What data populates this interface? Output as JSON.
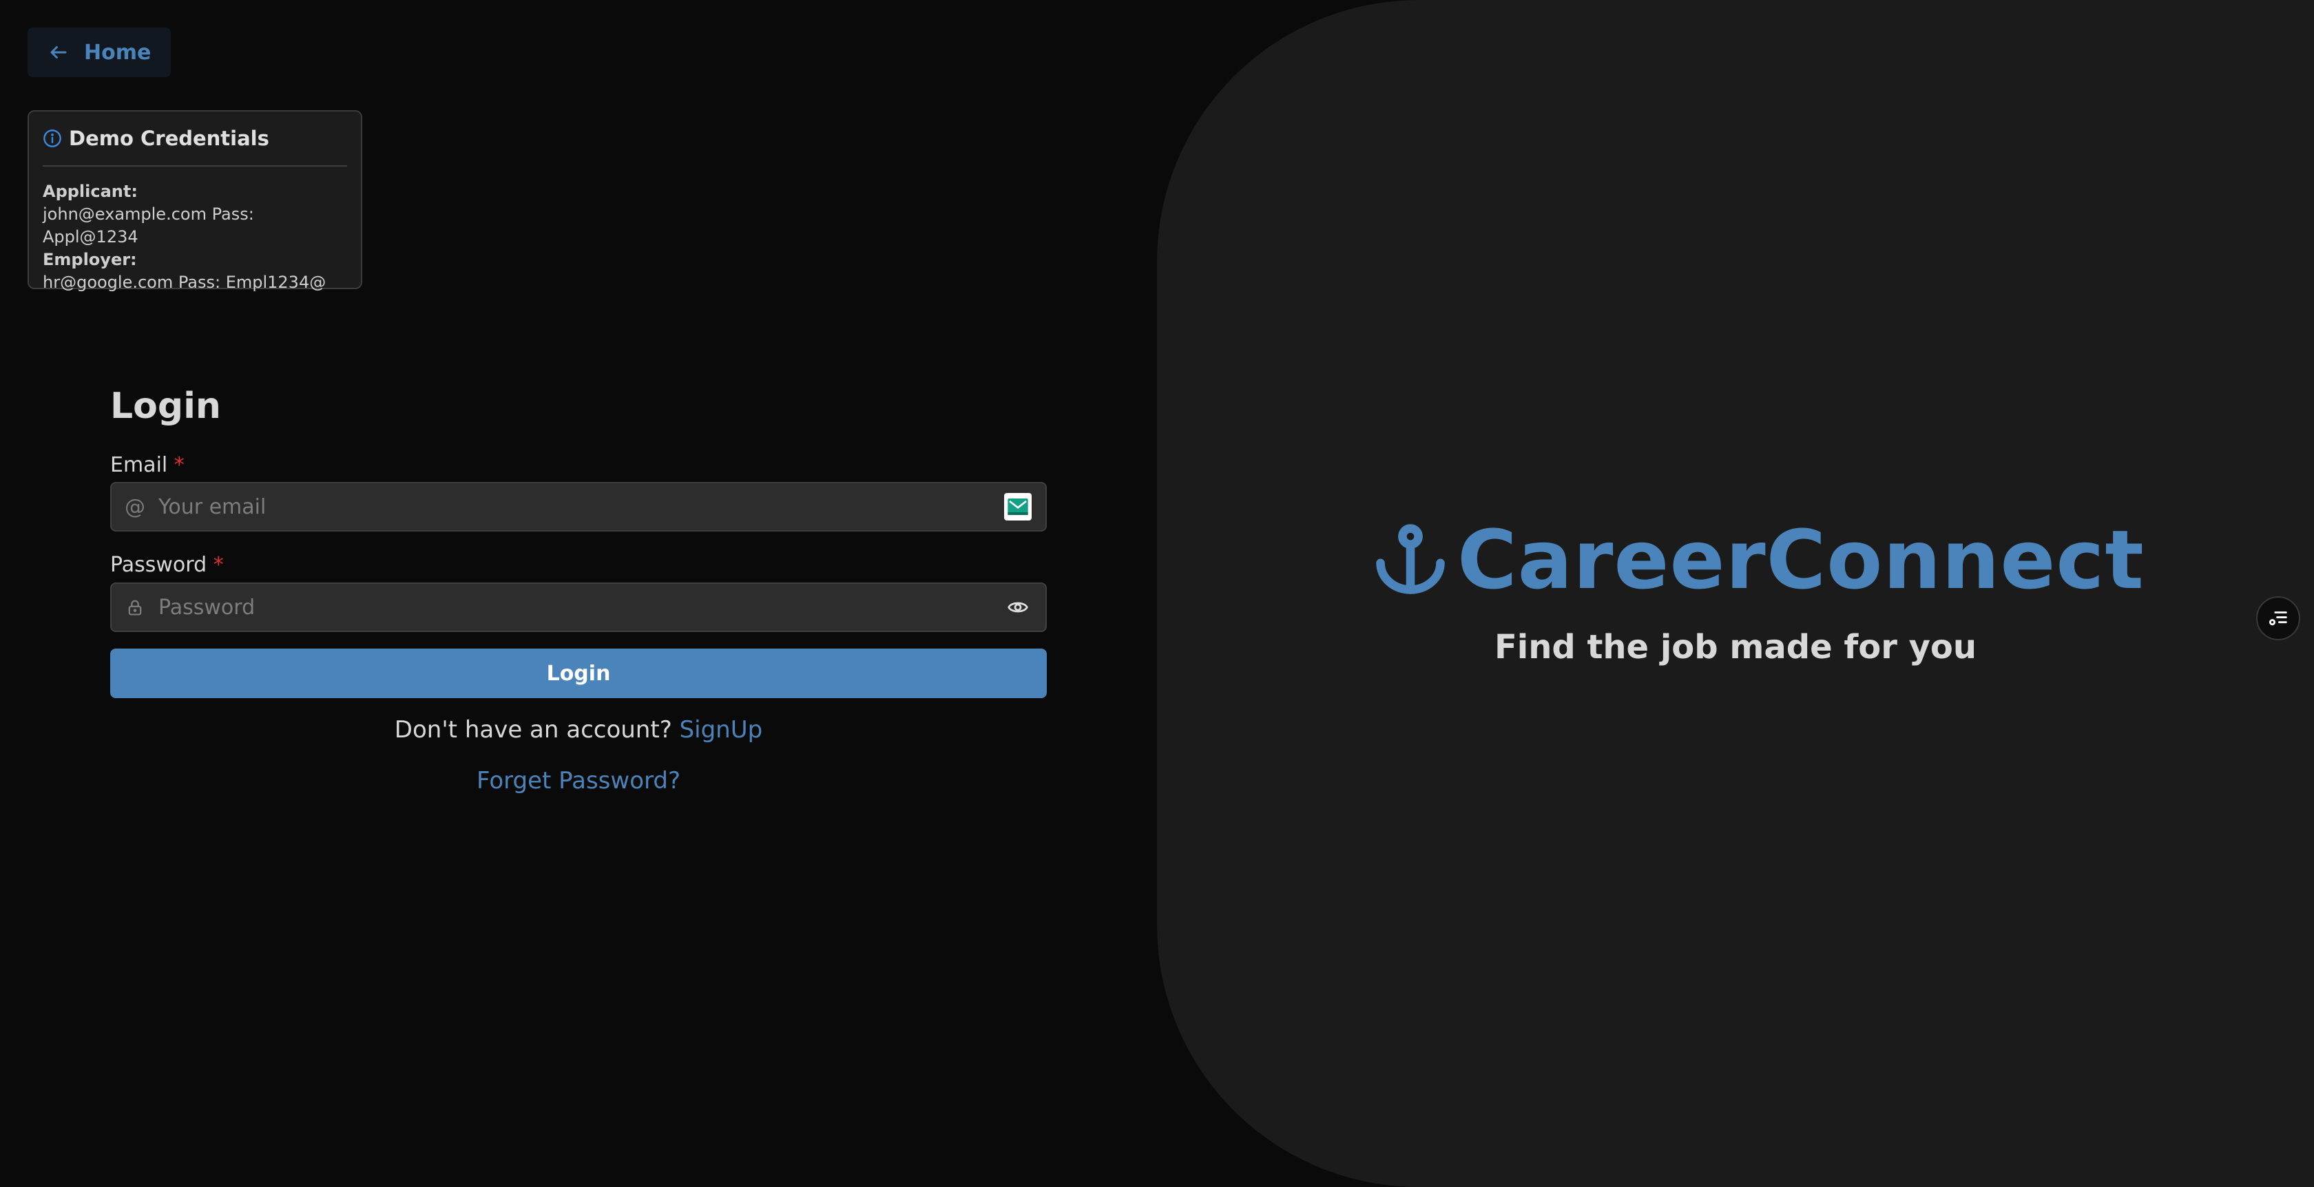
{
  "nav": {
    "home_label": "Home"
  },
  "demo": {
    "title": "Demo Credentials",
    "applicant_label": "Applicant:",
    "applicant_creds": "john@example.com Pass: Appl@1234",
    "employer_label": "Employer:",
    "employer_creds": "hr@google.com Pass: Empl1234@"
  },
  "form": {
    "title": "Login",
    "email_label": "Email",
    "email_placeholder": "Your email",
    "email_value": "",
    "password_label": "Password",
    "password_placeholder": "Password",
    "password_value": "",
    "required_mark": "*",
    "submit_label": "Login",
    "signup_prompt": "Don't have an account?",
    "signup_link": "SignUp",
    "forgot_link": "Forget Password?"
  },
  "brand": {
    "name": "CareerConnect",
    "tagline": "Find the job made for you",
    "color": "#4a84ba"
  },
  "icons": {
    "home": "arrow-left-icon",
    "info": "info-icon",
    "email_lead": "at-icon",
    "email_trail": "mail-icon",
    "password_lead": "lock-icon",
    "password_trail": "eye-icon",
    "brand": "anchor-icon",
    "float": "list-settings-icon"
  }
}
